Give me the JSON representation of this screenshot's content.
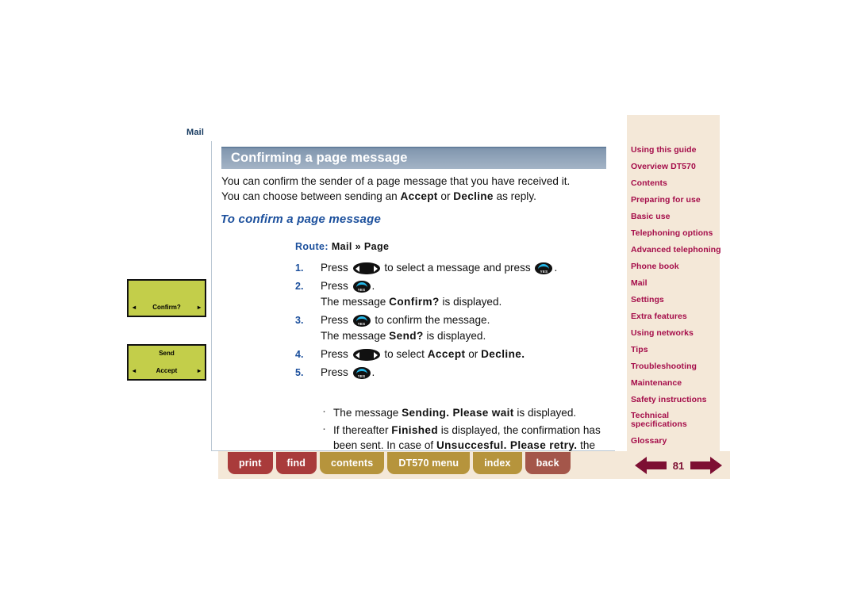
{
  "breadcrumb": "Mail",
  "colors": {
    "title_bar": "#8fa2b8",
    "heading_blue": "#1b4f9c",
    "sidebar_bg": "#f4e8d8",
    "sidebar_link": "#a50d4a",
    "lcd_green": "#c3ce4a",
    "btn_red": "#a93b3b",
    "btn_gold": "#b6943c",
    "btn_brown": "#a4564a",
    "pager_maroon": "#7d0f33"
  },
  "content": {
    "title": "Confirming a page message",
    "intro_line1_a": "You can confirm the sender of a page message that you have received it.",
    "intro_line2_a": "You can choose between sending an ",
    "intro_line2_b": "Accept",
    "intro_line2_c": " or ",
    "intro_line2_d": "Decline",
    "intro_line2_e": " as reply.",
    "subhead": "To confirm a page message",
    "route_label": "Route:",
    "route_value": "Mail » Page",
    "steps": [
      {
        "num": "1.",
        "press": "Press",
        "key1": "nav-key",
        "mid": "to select a message and press",
        "key2": "yes-key",
        "tail": "."
      },
      {
        "num": "2.",
        "press": "Press",
        "key1": "yes-key",
        "tail": ".",
        "sub_pre": "The message ",
        "sub_bold": "Confirm?",
        "sub_post": " is displayed."
      },
      {
        "num": "3.",
        "press": "Press",
        "key1": "yes-key",
        "mid": "to confirm the message.",
        "sub_pre": "The message ",
        "sub_bold": "Send?",
        "sub_post": " is displayed."
      },
      {
        "num": "4.",
        "press": "Press",
        "key1": "nav-key",
        "mid_pre": "to select ",
        "mid_bold1": "Accept",
        "mid_mid": " or ",
        "mid_bold2": "Decline."
      },
      {
        "num": "5.",
        "press": "Press",
        "key1": "yes-key",
        "tail": "."
      }
    ],
    "bullets": [
      {
        "pre": "The message ",
        "bold1": "Sending. Please wait",
        "post": " is displayed."
      },
      {
        "pre": "If thereafter ",
        "bold1": "Finished",
        "mid": " is displayed, the confirmation has been sent. In case of ",
        "bold2": "Unsuccesful. Please retry.",
        "post": " the confirmation was not sent."
      }
    ]
  },
  "displays": [
    {
      "top_text": "",
      "main_text": "Confirm?",
      "left_arrow": "◂",
      "right_arrow": "▸"
    },
    {
      "top_text": "Send",
      "main_text": "Accept",
      "left_arrow": "◂",
      "right_arrow": "▸"
    }
  ],
  "sidebar": {
    "items": [
      {
        "label": "Using this guide"
      },
      {
        "label": "Overview DT570"
      },
      {
        "label": "Contents"
      },
      {
        "label": "Preparing for use"
      },
      {
        "label": "Basic use"
      },
      {
        "label": "Telephoning options"
      },
      {
        "label": "Advanced telephoning"
      },
      {
        "label": "Phone book"
      },
      {
        "label": "Mail"
      },
      {
        "label": "Settings"
      },
      {
        "label": "Extra features"
      },
      {
        "label": "Using networks"
      },
      {
        "label": "Tips"
      },
      {
        "label": "Troubleshooting"
      },
      {
        "label": "Maintenance"
      },
      {
        "label": "Safety instructions"
      },
      {
        "label": "Technical specifications"
      },
      {
        "label": "Glossary"
      }
    ]
  },
  "bottom_nav": {
    "buttons": [
      {
        "label": "print",
        "style": "red"
      },
      {
        "label": "find",
        "style": "red"
      },
      {
        "label": "contents",
        "style": "gold"
      },
      {
        "label": "DT570 menu",
        "style": "gold"
      },
      {
        "label": "index",
        "style": "gold"
      },
      {
        "label": "back",
        "style": "brown"
      }
    ]
  },
  "pager": {
    "prev_icon": "left-arrow-icon",
    "page_number": "81",
    "next_icon": "right-arrow-icon"
  }
}
